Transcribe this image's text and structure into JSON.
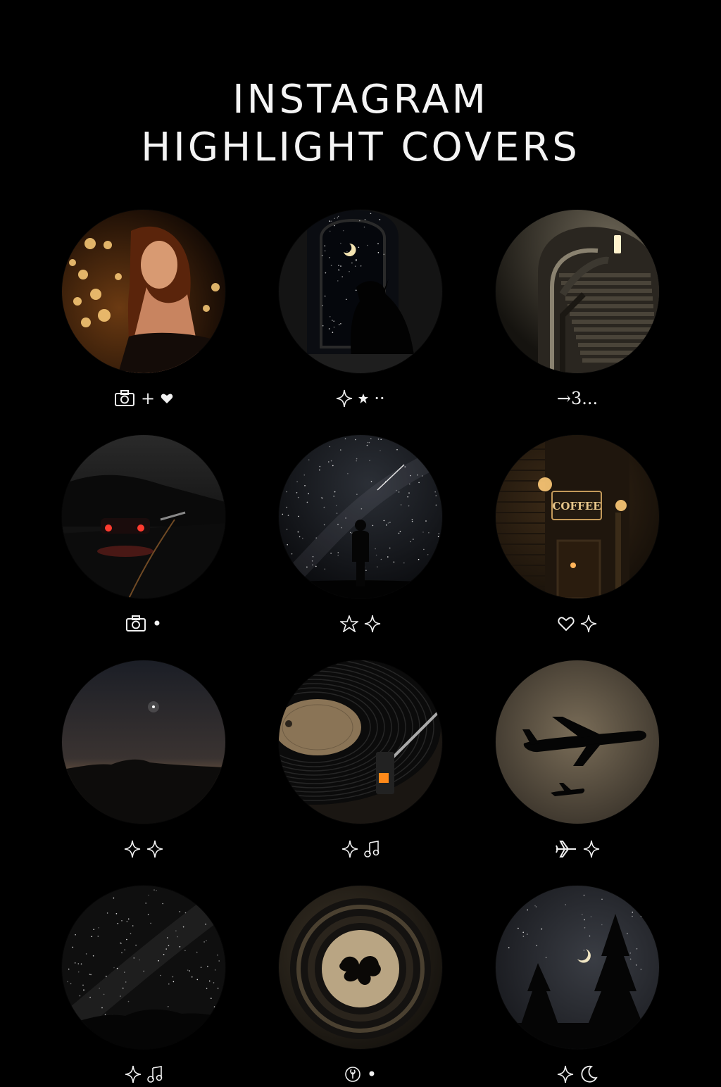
{
  "header": {
    "line1": "INSTAGRAM",
    "line2": "HIGHLIGHT COVERS"
  },
  "covers": [
    {
      "scene": "woman-bokeh",
      "label": [
        "camera-icon",
        "+",
        "heart-icon"
      ]
    },
    {
      "scene": "cat-window",
      "label": [
        "sparkle-icon",
        "star-icon",
        "··"
      ]
    },
    {
      "scene": "staircase",
      "label": [
        "→3..."
      ]
    },
    {
      "scene": "car-road",
      "label": [
        "camera-icon",
        "•"
      ]
    },
    {
      "scene": "stargazer",
      "label": [
        "star-outline-icon",
        "sparkle-icon"
      ]
    },
    {
      "scene": "coffee-shop",
      "label": [
        "heart-outline-icon",
        "sparkle-icon"
      ],
      "sign": "COFFEE"
    },
    {
      "scene": "horizon",
      "label": [
        "sparkle-icon",
        "sparkle-icon"
      ]
    },
    {
      "scene": "vinyl",
      "label": [
        "sparkle-icon",
        "music-icon"
      ]
    },
    {
      "scene": "airplanes",
      "label": [
        "plane-icon",
        "sparkle-icon"
      ]
    },
    {
      "scene": "milky-way",
      "label": [
        "sparkle-icon",
        "music-icon"
      ]
    },
    {
      "scene": "reel",
      "label": [
        "plant-icon",
        "•"
      ]
    },
    {
      "scene": "moon-trees",
      "label": [
        "sparkle-icon",
        "moon-icon"
      ]
    }
  ]
}
